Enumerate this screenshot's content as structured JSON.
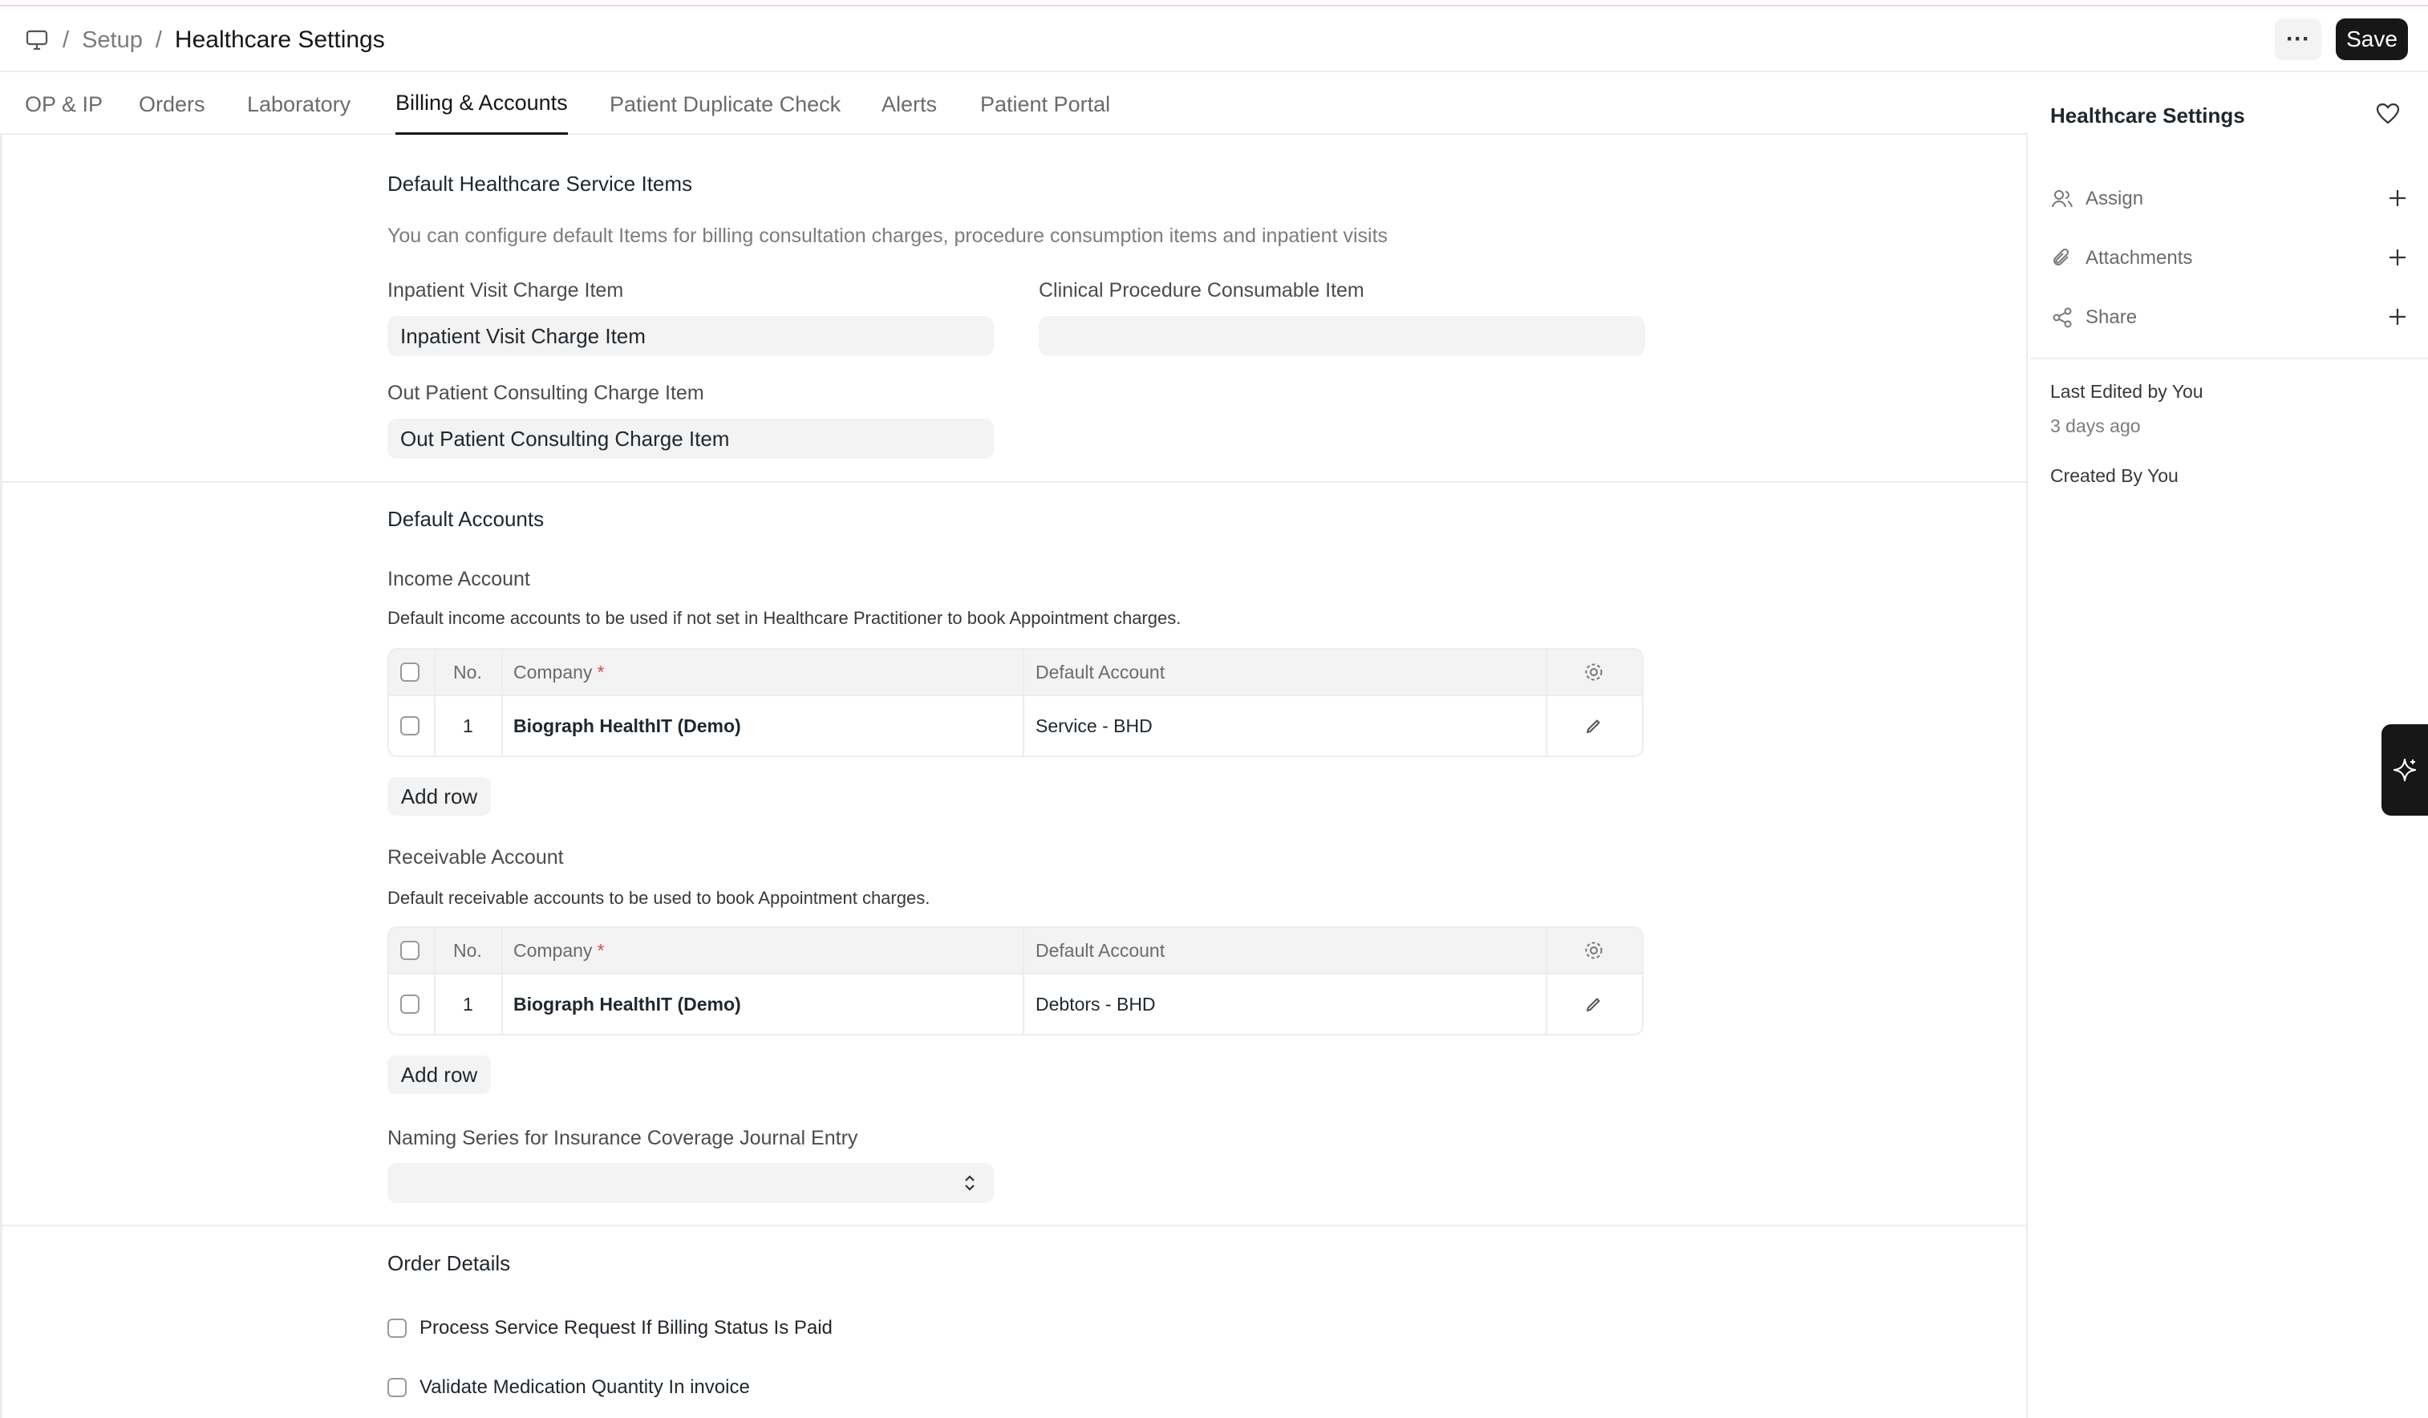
{
  "breadcrumb": {
    "parent": "Setup",
    "current": "Healthcare Settings",
    "separator": "/"
  },
  "header": {
    "more_label": "···",
    "save_label": "Save"
  },
  "tabs": [
    {
      "label": "OP & IP"
    },
    {
      "label": "Orders"
    },
    {
      "label": "Laboratory"
    },
    {
      "label": "Billing & Accounts",
      "active": true
    },
    {
      "label": "Patient Duplicate Check"
    },
    {
      "label": "Alerts"
    },
    {
      "label": "Patient Portal"
    }
  ],
  "service_items": {
    "heading": "Default Healthcare Service Items",
    "description": "You can configure default Items for billing consultation charges, procedure consumption items and inpatient visits",
    "inpatient": {
      "label": "Inpatient Visit Charge Item",
      "value": "Inpatient Visit Charge Item"
    },
    "procedure": {
      "label": "Clinical Procedure Consumable Item",
      "value": ""
    },
    "outpatient": {
      "label": "Out Patient Consulting Charge Item",
      "value": "Out Patient Consulting Charge Item"
    }
  },
  "accounts": {
    "heading": "Default Accounts",
    "income": {
      "label": "Income Account",
      "description": "Default income accounts to be used if not set in Healthcare Practitioner to book Appointment charges.",
      "columns": {
        "no": "No.",
        "company": "Company",
        "required_mark": "*",
        "account": "Default Account"
      },
      "rows": [
        {
          "no": "1",
          "company": "Biograph HealthIT (Demo)",
          "account": "Service - BHD"
        }
      ],
      "add_row": "Add row"
    },
    "receivable": {
      "label": "Receivable Account",
      "description": "Default receivable accounts to be used to book Appointment charges.",
      "columns": {
        "no": "No.",
        "company": "Company",
        "required_mark": "*",
        "account": "Default Account"
      },
      "rows": [
        {
          "no": "1",
          "company": "Biograph HealthIT (Demo)",
          "account": "Debtors - BHD"
        }
      ],
      "add_row": "Add row"
    },
    "naming_series": {
      "label": "Naming Series for Insurance Coverage Journal Entry",
      "value": ""
    }
  },
  "order_details": {
    "heading": "Order Details",
    "options": [
      {
        "label": "Process Service Request If Billing Status Is Paid",
        "checked": false
      },
      {
        "label": "Validate Medication Quantity In invoice",
        "checked": false
      }
    ]
  },
  "sidebar": {
    "title": "Healthcare Settings",
    "items": [
      {
        "label": "Assign"
      },
      {
        "label": "Attachments"
      },
      {
        "label": "Share"
      }
    ],
    "last_edited": "Last Edited by You",
    "edited_ago": "3 days ago",
    "created_by": "Created By You"
  },
  "colors": {
    "accent": "#171717",
    "required": "#e24c4c",
    "field_bg": "#f3f3f3",
    "border": "#ededed"
  }
}
